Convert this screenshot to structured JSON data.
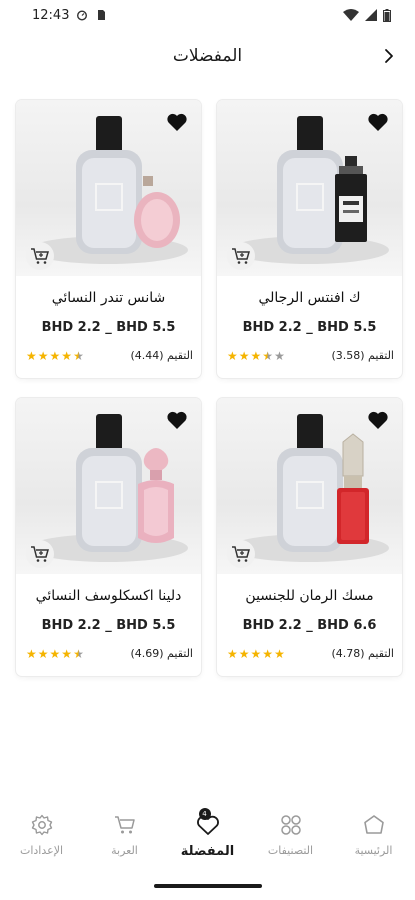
{
  "status_bar": {
    "time": "12:43"
  },
  "header": {
    "title": "المفضلات"
  },
  "products": [
    {
      "name": "ك افنتس الرجالي",
      "price": "BHD 2.2 _ BHD 5.5",
      "rating_text": "التقيم (3.58)",
      "rating": 3.58,
      "image_variant": "black-bottle"
    },
    {
      "name": "شانس تندر النسائي",
      "price": "BHD 2.2 _ BHD 5.5",
      "rating_text": "التقيم (4.44)",
      "rating": 4.44,
      "image_variant": "pink-round-bottle"
    },
    {
      "name": "مسك الرمان للجنسين",
      "price": "BHD 2.2 _ BHD 6.6",
      "rating_text": "التقيم (4.78)",
      "rating": 4.78,
      "image_variant": "red-ornate-bottle"
    },
    {
      "name": "دلينا اكسكلوسف النسائي",
      "price": "BHD 2.2 _ BHD 5.5",
      "rating_text": "التقيم (4.69)",
      "rating": 4.69,
      "image_variant": "pink-ornate-bottle"
    }
  ],
  "bottom_nav": {
    "items": [
      {
        "label": "الرئيسية",
        "icon": "home-icon"
      },
      {
        "label": "التصنيفات",
        "icon": "categories-icon"
      },
      {
        "label": "المفضلة",
        "icon": "heart-icon",
        "active": true,
        "badge": "4"
      },
      {
        "label": "العربة",
        "icon": "cart-icon"
      },
      {
        "label": "الإعدادات",
        "icon": "settings-icon"
      }
    ]
  },
  "colors": {
    "star": "#f5b400",
    "star_empty": "#9a9a9a",
    "text": "#1a1a1a",
    "muted": "#9a9a9a"
  }
}
